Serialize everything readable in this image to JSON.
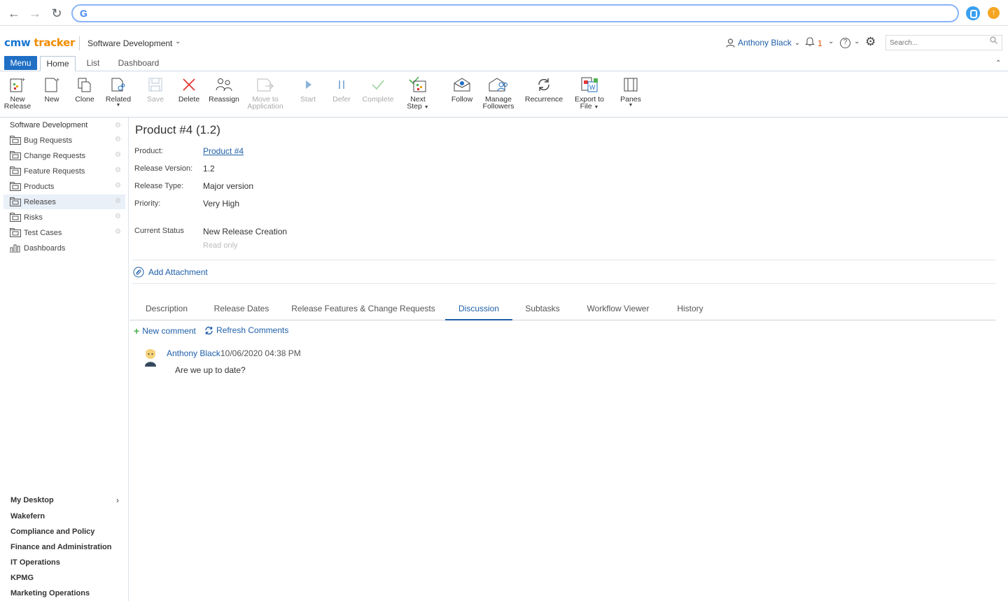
{
  "app": {
    "logo_part1": "cmw",
    "logo_part2": "tracker",
    "workspace": "Software Development",
    "user": "Anthony Black",
    "notification_count": "1",
    "search_placeholder": "Search..."
  },
  "ribbon_tabs": {
    "menu": "Menu",
    "home": "Home",
    "list": "List",
    "dashboard": "Dashboard"
  },
  "toolbar": {
    "new_release_1": "New",
    "new_release_2": "Release",
    "new": "New",
    "clone": "Clone",
    "related": "Related",
    "save": "Save",
    "delete": "Delete",
    "reassign": "Reassign",
    "move_1": "Move to",
    "move_2": "Application",
    "start": "Start",
    "defer": "Defer",
    "complete": "Complete",
    "next_1": "Next",
    "next_2": "Step",
    "follow": "Follow",
    "manage_1": "Manage",
    "manage_2": "Followers",
    "recurrence": "Recurrence",
    "export_1": "Export to",
    "export_2": "File",
    "panes": "Panes"
  },
  "sidebar": {
    "root": "Software Development",
    "items": [
      {
        "label": "Bug Requests"
      },
      {
        "label": "Change Requests"
      },
      {
        "label": "Feature Requests"
      },
      {
        "label": "Products"
      },
      {
        "label": "Releases"
      },
      {
        "label": "Risks"
      },
      {
        "label": "Test Cases"
      },
      {
        "label": "Dashboards"
      }
    ],
    "bottom": [
      "My Desktop",
      "Wakefern",
      "Compliance and Policy",
      "Finance and Administration",
      "IT Operations",
      "KPMG",
      "Marketing Operations"
    ]
  },
  "record": {
    "title": "Product #4 (1.2)",
    "product_label": "Product:",
    "product_value": "Product #4",
    "version_label": "Release Version:",
    "version_value": "1.2",
    "type_label": "Release Type:",
    "type_value": "Major version",
    "priority_label": "Priority:",
    "priority_value": "Very High",
    "status_label": "Current Status",
    "status_value": "New Release Creation",
    "status_note": "Read only",
    "add_attachment": "Add Attachment"
  },
  "content_tabs": [
    "Description",
    "Release Dates",
    "Release Features & Change Requests",
    "Discussion",
    "Subtasks",
    "Workflow Viewer",
    "History"
  ],
  "discussion": {
    "new_comment": "New comment",
    "refresh": "Refresh Comments",
    "comments": [
      {
        "author": "Anthony Black",
        "date": "10/06/2020 04:38 PM",
        "text": "Are we up to date?"
      }
    ]
  },
  "colors": {
    "accent": "#1f6fc5",
    "link": "#1f5fa8",
    "brand_orange": "#f08c00"
  }
}
